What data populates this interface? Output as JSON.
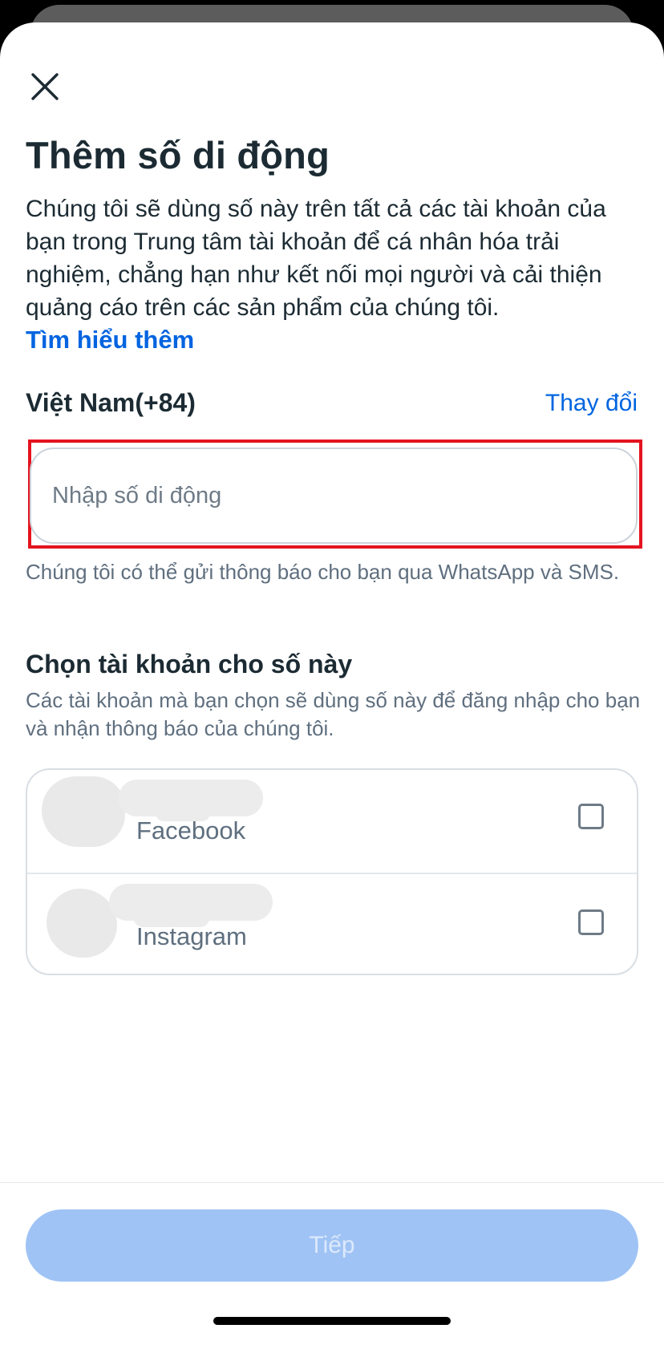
{
  "header": {
    "close_icon": "close-icon",
    "title": "Thêm số di động"
  },
  "description": {
    "text": "Chúng tôi sẽ dùng số này trên tất cả các tài khoản của bạn trong Trung tâm tài khoản để cá nhân hóa trải nghiệm, chẳng hạn như kết nối mọi người và cải thiện quảng cáo trên các sản phẩm của chúng tôi.",
    "learn_more": "Tìm hiểu thêm"
  },
  "phone": {
    "country": "Việt Nam(+84)",
    "change_label": "Thay đổi",
    "value": "",
    "placeholder": "Nhập số di động",
    "helper": "Chúng tôi có thể gửi thông báo cho bạn qua WhatsApp và SMS."
  },
  "accounts": {
    "title": "Chọn tài khoản cho số này",
    "description": "Các tài khoản mà bạn chọn sẽ dùng số này để đăng nhập cho bạn và nhận thông báo của chúng tôi.",
    "items": [
      {
        "platform": "Facebook",
        "checked": false
      },
      {
        "platform": "Instagram",
        "checked": false
      }
    ]
  },
  "footer": {
    "next_label": "Tiếp",
    "next_enabled": false
  },
  "colors": {
    "accent": "#0064e0",
    "text_primary": "#1c2b33",
    "text_secondary": "#5f6f7f",
    "highlight": "#e4131f",
    "button_disabled": "#9fc3f5"
  }
}
